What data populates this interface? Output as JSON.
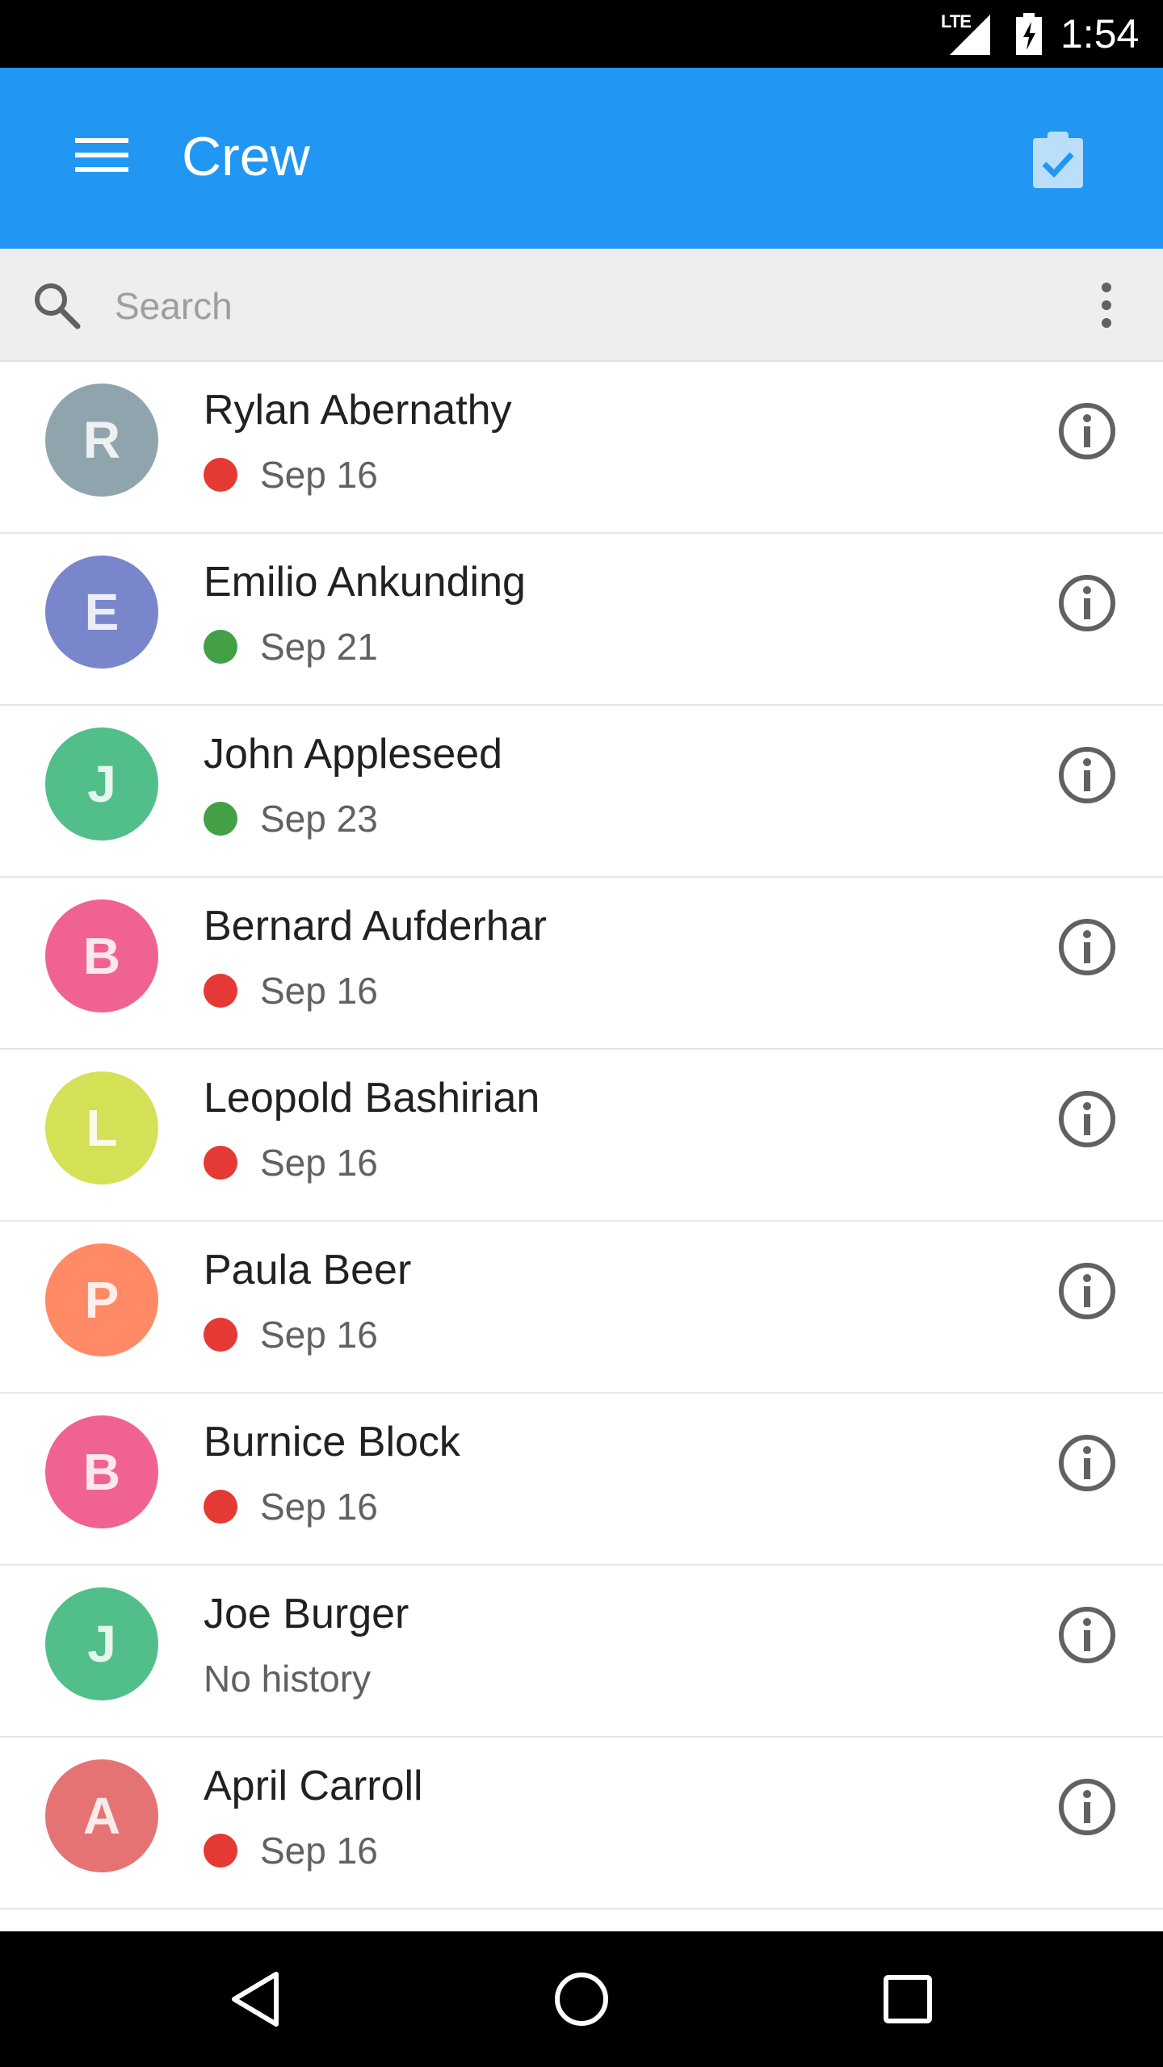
{
  "status_bar": {
    "network": "LTE",
    "time": "1:54"
  },
  "app_bar": {
    "title": "Crew",
    "background": "#2196f3"
  },
  "search": {
    "placeholder": "Search",
    "value": ""
  },
  "crew": [
    {
      "initial": "R",
      "name": "Rylan Abernathy",
      "last_seen": "Sep 16",
      "status": "red",
      "avatar_color": "#90a4ae"
    },
    {
      "initial": "E",
      "name": "Emilio Ankunding",
      "last_seen": "Sep 21",
      "status": "green",
      "avatar_color": "#7986cb"
    },
    {
      "initial": "J",
      "name": "John Appleseed",
      "last_seen": "Sep 23",
      "status": "green",
      "avatar_color": "#52bf8b"
    },
    {
      "initial": "B",
      "name": "Bernard Aufderhar",
      "last_seen": "Sep 16",
      "status": "red",
      "avatar_color": "#f06292"
    },
    {
      "initial": "L",
      "name": "Leopold Bashirian",
      "last_seen": "Sep 16",
      "status": "red",
      "avatar_color": "#d4e157"
    },
    {
      "initial": "P",
      "name": "Paula Beer",
      "last_seen": "Sep 16",
      "status": "red",
      "avatar_color": "#ff8a65"
    },
    {
      "initial": "B",
      "name": "Burnice Block",
      "last_seen": "Sep 16",
      "status": "red",
      "avatar_color": "#f06292"
    },
    {
      "initial": "J",
      "name": "Joe Burger",
      "last_seen": "No history",
      "status": "none",
      "avatar_color": "#52bf8b"
    },
    {
      "initial": "A",
      "name": "April Carroll",
      "last_seen": "Sep 16",
      "status": "red",
      "avatar_color": "#e57373"
    }
  ],
  "status_colors": {
    "red": "#e53935",
    "green": "#43a047"
  },
  "icons": {
    "menu": "menu-icon",
    "assignment": "assignment-turned-in-icon",
    "search": "search-icon",
    "more": "more-vert-icon",
    "info": "info-icon",
    "back": "back-triangle-icon",
    "home": "home-circle-icon",
    "recents": "recents-square-icon"
  }
}
